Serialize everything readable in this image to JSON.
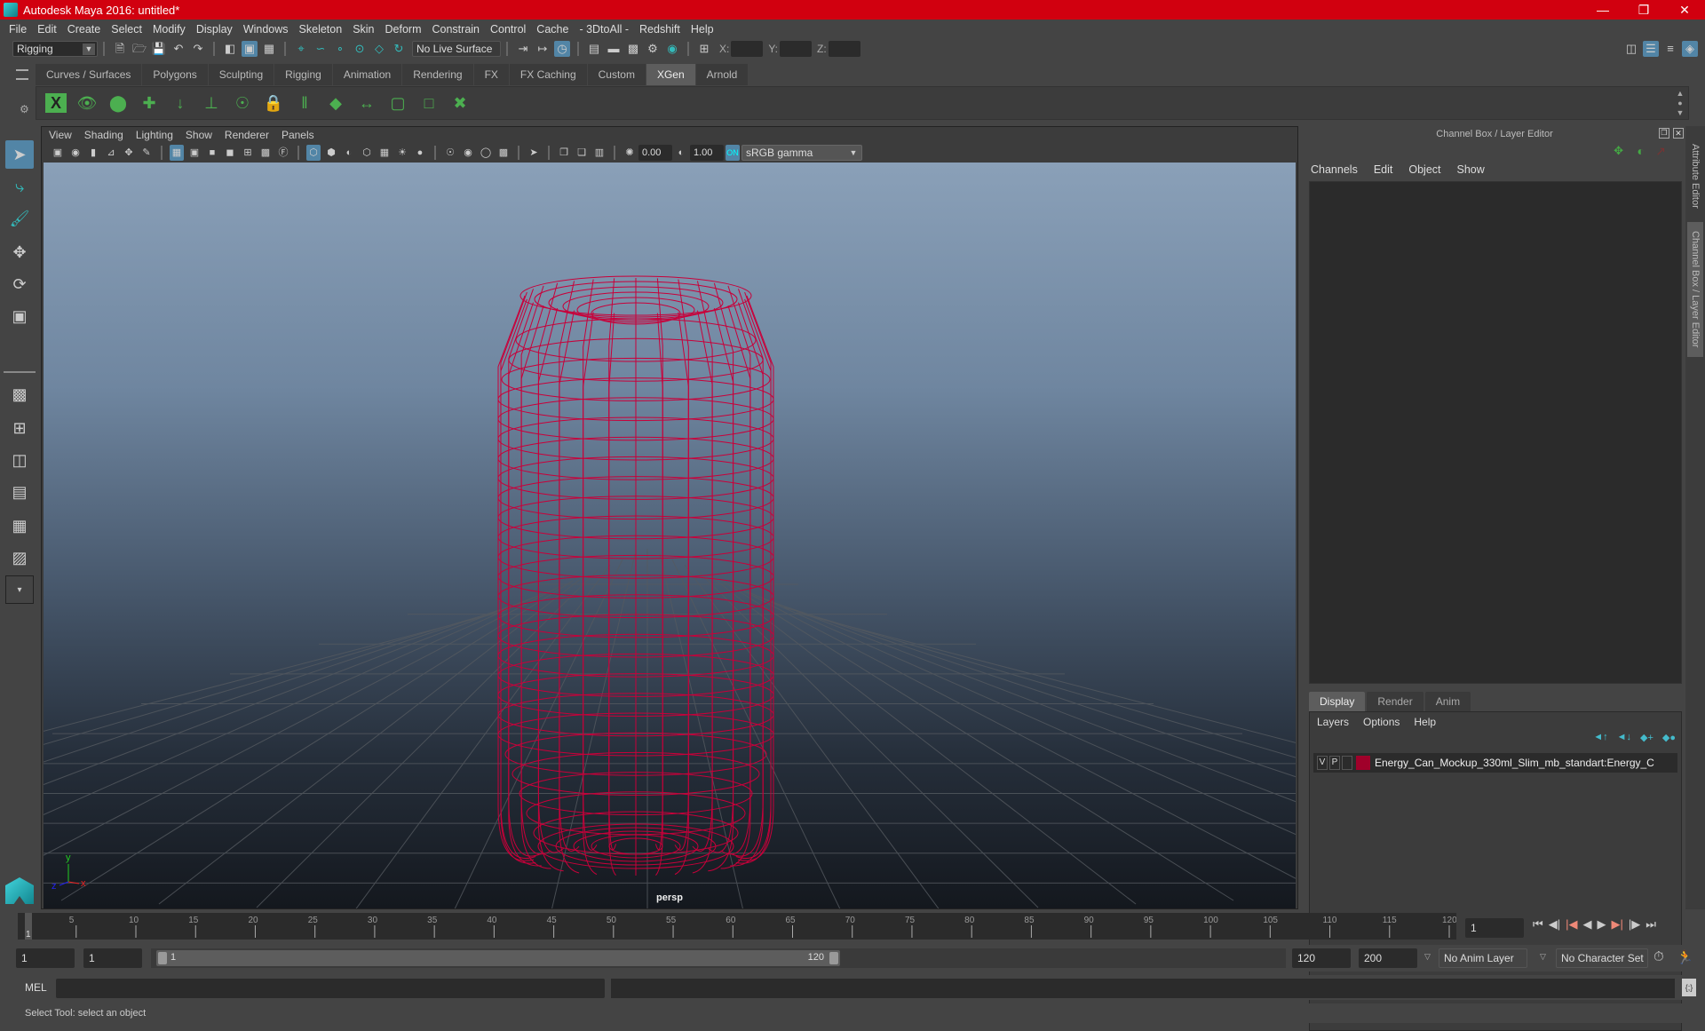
{
  "window": {
    "title": "Autodesk Maya 2016: untitled*",
    "controls": [
      "minimize",
      "restore",
      "close"
    ]
  },
  "menubar": [
    "File",
    "Edit",
    "Create",
    "Select",
    "Modify",
    "Display",
    "Windows",
    "Skeleton",
    "Skin",
    "Deform",
    "Constrain",
    "Control",
    "Cache",
    "- 3DtoAll -",
    "Redshift",
    "Help"
  ],
  "statusline": {
    "menu_set": "Rigging",
    "live_surface": "No Live Surface",
    "x_label": "X:",
    "y_label": "Y:",
    "z_label": "Z:",
    "x_value": "",
    "y_value": "",
    "z_value": ""
  },
  "shelf": {
    "tabs": [
      "Curves / Surfaces",
      "Polygons",
      "Sculpting",
      "Rigging",
      "Animation",
      "Rendering",
      "FX",
      "FX Caching",
      "Custom",
      "XGen",
      "Arnold"
    ],
    "active_tab": "XGen",
    "icons": [
      "xgen-window-icon",
      "xgen-show-icon",
      "xgen-hide-icon",
      "add-description-icon",
      "place-primitives-icon",
      "add-guide-icon",
      "select-guide-icon",
      "lock-guide-icon",
      "guide-split-icon",
      "patch-icon",
      "flip-guide-icon",
      "select-region-icon",
      "bounding-box-icon",
      "delete-guide-icon"
    ]
  },
  "viewport": {
    "menu": [
      "View",
      "Shading",
      "Lighting",
      "Show",
      "Renderer",
      "Panels"
    ],
    "exposure": "0.00",
    "gamma": "1.00",
    "color_space": "sRGB gamma",
    "camera_label": "persp",
    "axis_labels": {
      "x": "x",
      "y": "y",
      "z": "z"
    },
    "wire_color": "#c8003a"
  },
  "channel_box": {
    "header": "Channel Box / Layer Editor",
    "menu": [
      "Channels",
      "Edit",
      "Object",
      "Show"
    ],
    "layer_tabs": [
      "Display",
      "Render",
      "Anim"
    ],
    "active_layer_tab": "Display",
    "layer_menu": [
      "Layers",
      "Options",
      "Help"
    ],
    "layers": [
      {
        "v": "V",
        "p": "P",
        "color": "#a0002a",
        "name": "Energy_Can_Mockup_330ml_Slim_mb_standart:Energy_C"
      }
    ]
  },
  "side_tabs": [
    "Attribute Editor",
    "Channel Box / Layer Editor"
  ],
  "time_slider": {
    "ticks": [
      "5",
      "10",
      "15",
      "20",
      "25",
      "30",
      "35",
      "40",
      "45",
      "50",
      "55",
      "60",
      "65",
      "70",
      "75",
      "80",
      "85",
      "90",
      "95",
      "100",
      "105",
      "110",
      "115",
      "120"
    ],
    "current_frame_marker": "1",
    "current_frame": "1"
  },
  "range_slider": {
    "start_time": "1",
    "playback_start": "1",
    "range_start_label": "1",
    "range_end_label": "120",
    "playback_end": "120",
    "end_time": "200",
    "anim_layer": "No Anim Layer",
    "character_set": "No Character Set"
  },
  "command_line": {
    "label": "MEL",
    "value": "",
    "result": ""
  },
  "help_line": "Select Tool: select an object"
}
